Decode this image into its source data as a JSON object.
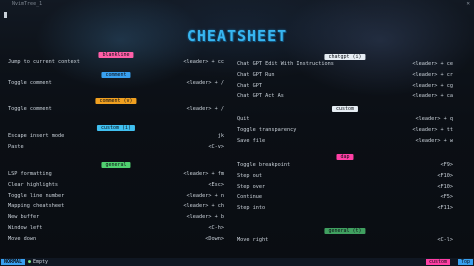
{
  "window": {
    "title": "NvimTree_1",
    "close": "✕"
  },
  "banner": "CHEATSHEET",
  "left": {
    "sections": [
      {
        "label": "blankline",
        "bg": "#ff5fa8",
        "fg": "#0b0f15",
        "items": [
          {
            "key": "Jump to current context",
            "value": "<leader> + cc"
          }
        ]
      },
      {
        "label": "comment",
        "bg": "#38a0f0",
        "fg": "#0b0f15",
        "items": [
          {
            "key": "Toggle comment",
            "value": "<leader> + /"
          }
        ]
      },
      {
        "label": "comment (v)",
        "bg": "#f0a020",
        "fg": "#0b0f15",
        "items": [
          {
            "key": "Toggle comment",
            "value": "<leader> + /"
          }
        ]
      },
      {
        "label": "custom (i)",
        "bg": "#40c0f0",
        "fg": "#0b0f15",
        "items": [
          {
            "key": "Escape insert mode",
            "value": "jk"
          },
          {
            "key": "Paste",
            "value": "<C-v>"
          }
        ]
      },
      {
        "label": "general",
        "bg": "#50d070",
        "fg": "#0b0f15",
        "items": [
          {
            "key": "LSP formatting",
            "value": "<leader> + fm"
          },
          {
            "key": "Clear highlights",
            "value": "<Esc>"
          },
          {
            "key": "Toggle line number",
            "value": "<leader> + n"
          },
          {
            "key": "Mapping cheatsheet",
            "value": "<leader> + ch"
          },
          {
            "key": "New buffer",
            "value": "<leader> + b"
          },
          {
            "key": "Window left",
            "value": "<C-h>"
          },
          {
            "key": "Move down",
            "value": "<Down>"
          }
        ]
      }
    ]
  },
  "right": {
    "sections": [
      {
        "label": "chatgpt (i)",
        "bg": "#e6edf3",
        "fg": "#0b0f15",
        "items": [
          {
            "key": "Chat GPT Edit With Instructions",
            "value": "<leader> + ce"
          },
          {
            "key": "Chat GPT Run",
            "value": "<leader> + cr"
          },
          {
            "key": "Chat GPT",
            "value": "<leader> + cg"
          },
          {
            "key": "Chat GPT Act As",
            "value": "<leader> + ca"
          }
        ]
      },
      {
        "label": "custom",
        "bg": "#e6edf3",
        "fg": "#0b0f15",
        "items": [
          {
            "key": "Quit",
            "value": "<leader> + q"
          },
          {
            "key": "Toggle transparency",
            "value": "<leader> + tt"
          },
          {
            "key": "Save file",
            "value": "<leader> + w"
          }
        ]
      },
      {
        "label": "dap",
        "bg": "#ff3fa4",
        "fg": "#0b0f15",
        "items": [
          {
            "key": "Toggle breakpoint",
            "value": "<F9>"
          },
          {
            "key": "Step out",
            "value": "<F10>"
          },
          {
            "key": "Step over",
            "value": "<F10>"
          },
          {
            "key": "Continue",
            "value": "<F5>"
          },
          {
            "key": "Step into",
            "value": "<F11>"
          }
        ]
      },
      {
        "label": "general (t)",
        "bg": "#40a060",
        "fg": "#0b0f15",
        "items": [
          {
            "key": "Move right",
            "value": "<C-l>"
          }
        ]
      }
    ]
  },
  "status": {
    "mode": "NORMAL",
    "file": "Empty",
    "filetype": "custom",
    "position": "Top"
  }
}
